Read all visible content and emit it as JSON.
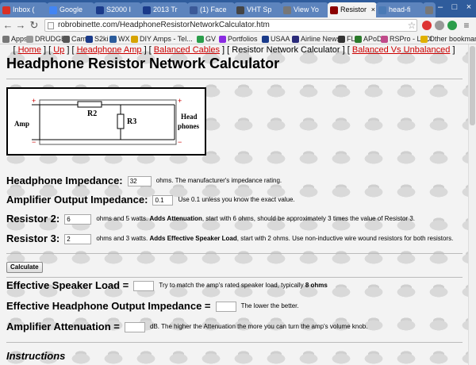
{
  "browser": {
    "tabs": [
      {
        "label": "Inbox (",
        "color": "#d93025"
      },
      {
        "label": "Google",
        "color": "#4285f4"
      },
      {
        "label": "S2000 I",
        "color": "#1a3a8a"
      },
      {
        "label": "2013 Tr",
        "color": "#1a3a8a"
      },
      {
        "label": "(1) Face",
        "color": "#3b5998"
      },
      {
        "label": "VHT Sp",
        "color": "#444444"
      },
      {
        "label": "View Yo",
        "color": "#777777"
      },
      {
        "label": "Resistor",
        "color": "#8b0000"
      },
      {
        "label": "head-fi",
        "color": "#4a7ab5"
      },
      {
        "label": "Create (",
        "color": "#777777"
      }
    ],
    "active_tab": 7,
    "url": "robrobinette.com/HeadphoneResistorNetworkCalculator.htm",
    "bookmarks": [
      {
        "label": "Apps",
        "color": "#777777"
      },
      {
        "label": "DRUDGE",
        "color": "#999999"
      },
      {
        "label": "Cam",
        "color": "#555555"
      },
      {
        "label": "S2ki",
        "color": "#1a3a8a"
      },
      {
        "label": "WX",
        "color": "#2b5c9c"
      },
      {
        "label": "DIY Amps - Tel...",
        "color": "#d6a300"
      },
      {
        "label": "GV",
        "color": "#2a9d4a"
      },
      {
        "label": "Portfolios",
        "color": "#8a2be2"
      },
      {
        "label": "USAA",
        "color": "#1a3a8a"
      },
      {
        "label": "Airline News",
        "color": "#2b2b7a"
      },
      {
        "label": "FL",
        "color": "#333333"
      },
      {
        "label": "APoD",
        "color": "#2b7a2b"
      },
      {
        "label": "RSPro - LuCI",
        "color": "#c04a8a"
      },
      {
        "label": "Other bookmarks",
        "color": "#e0b000"
      }
    ]
  },
  "nav": {
    "prefix": "[ ",
    "home": "Home",
    "sep": " ] [ ",
    "up": "Up",
    "headphone_amp": "Headphone Amp",
    "balanced_cables": "Balanced Cables",
    "current": "Resistor Network Calculator",
    "balanced_vs": "Balanced Vs Unbalanced",
    "suffix": " ]"
  },
  "page_title": "Headphone Resistor Network Calculator",
  "diagram": {
    "r2": "R2",
    "r3": "R3",
    "amp": "Amp",
    "head": "Head",
    "phones": "phones",
    "plus": "+",
    "minus": "−"
  },
  "fields": {
    "headphone_impedance": {
      "label": "Headphone Impedance:",
      "value": "32",
      "note": "ohms. The manufacturer's impedance rating."
    },
    "amp_output_impedance": {
      "label": "Amplifier Output Impedance:",
      "value": "0.1",
      "note": "Use 0.1 unless you know the exact value."
    },
    "resistor2": {
      "label": "Resistor 2:",
      "value": "6",
      "note_a": "ohms and 5 watts. ",
      "note_b": "Adds Attenuation",
      "note_c": ", start with 6 ohms, should be approximately 3 times the value of Resistor 3."
    },
    "resistor3": {
      "label": "Resistor 3:",
      "value": "2",
      "note_a": "ohms and 3 watts. ",
      "note_b": "Adds Effective Speaker Load",
      "note_c": ", start with 2 ohms. Use non-inductive wire wound resistors for both resistors."
    }
  },
  "calculate_label": "Calculate",
  "results": {
    "effective_load": {
      "label": "Effective Speaker Load =",
      "value": "",
      "note_a": "Try to match the amp's rated speaker load, typically ",
      "note_b": "8 ohms"
    },
    "effective_hp_output": {
      "label": "Effective Headphone Output Impedance =",
      "value": "",
      "note": "The lower the better."
    },
    "attenuation": {
      "label": "Amplifier Attenuation =",
      "value": "",
      "note": "dB. The higher the Attenuation the more you can turn the amp's volume knob."
    }
  },
  "instructions_heading": "Instructions"
}
